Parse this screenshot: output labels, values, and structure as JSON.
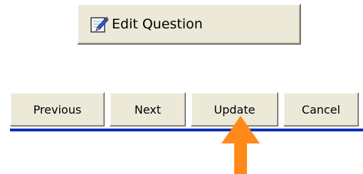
{
  "edit_question": {
    "label": "Edit Question",
    "icon": "edit-pencil-icon"
  },
  "toolbar": {
    "buttons": [
      {
        "label": "Previous"
      },
      {
        "label": "Next"
      },
      {
        "label": "Update"
      },
      {
        "label": "Cancel"
      }
    ]
  },
  "colors": {
    "button_face": "#ece9d8",
    "divider": "#0a2fb8",
    "arrow": "#ff8a19"
  },
  "pointer": {
    "icon": "up-arrow-icon",
    "target": "Update"
  }
}
